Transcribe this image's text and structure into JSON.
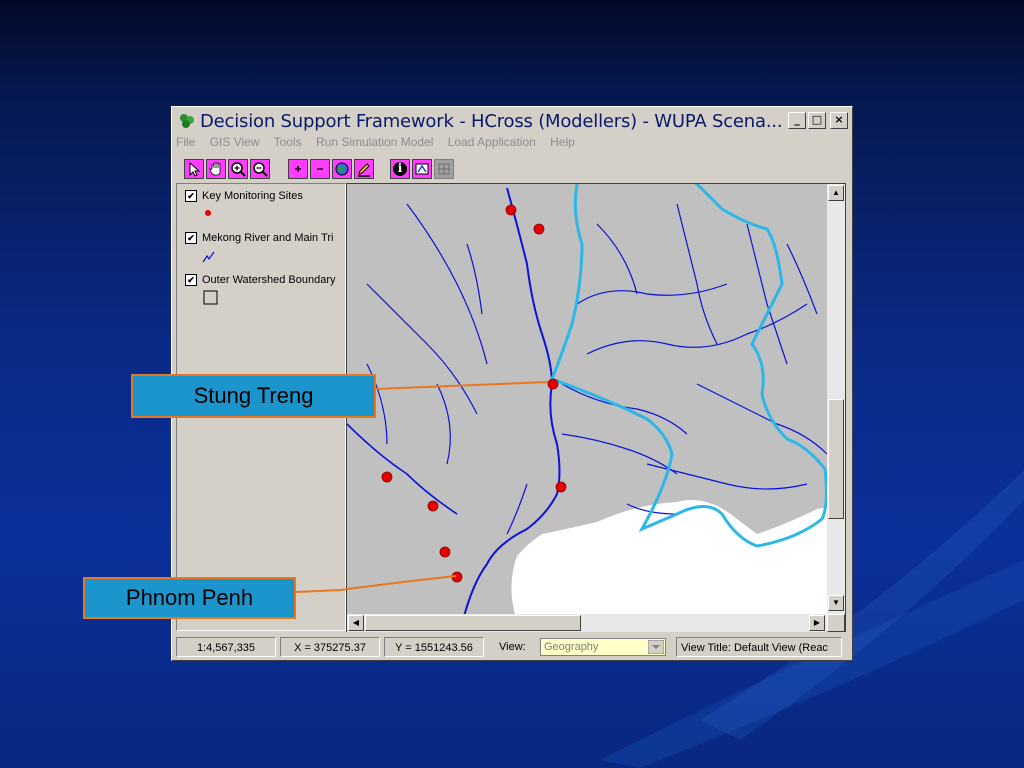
{
  "window": {
    "title": "Decision Support Framework - HCross (Modellers) - WUPA Scena...",
    "controls": {
      "minimize": "_",
      "maximize": "□",
      "close": "×"
    }
  },
  "menu": [
    "File",
    "GIS View",
    "Tools",
    "Run Simulation Model",
    "Load Application",
    "Help"
  ],
  "toolbar": {
    "tools": [
      "pointer-tool",
      "pan-tool",
      "zoom-in-tool",
      "zoom-out-tool",
      "zoom-in-fixed-tool",
      "zoom-out-fixed-tool",
      "layer-tool",
      "pencil-tool",
      "info-tool",
      "identify-tool",
      "grid-tool"
    ],
    "info_symbol": "i"
  },
  "legend": {
    "layers": [
      {
        "label": "Key Monitoring Sites",
        "checked": true
      },
      {
        "label": "Mekong River and Main Tri",
        "checked": true
      },
      {
        "label": "Outer Watershed Boundary",
        "checked": true
      }
    ],
    "check_mark": "✔"
  },
  "statusbar": {
    "scale": "1:4,567,335",
    "x": "X = 375275.37",
    "y": "Y = 1551243.56",
    "view_label": "View:",
    "view_value": "Geography",
    "view_title": "View Title: Default View (Reac"
  },
  "scroll": {
    "up": "▲",
    "down": "▼",
    "left": "◀",
    "right": "▶"
  },
  "callouts": {
    "stung_treng": "Stung Treng",
    "phnom_penh": "Phnom Penh"
  },
  "colors": {
    "river": "#0a14d8",
    "land": "#c0c0c0",
    "site": "#e60000",
    "boundary": "#2bb8e8",
    "callout_fill": "#1c94cc",
    "callout_border": "#e87722"
  }
}
